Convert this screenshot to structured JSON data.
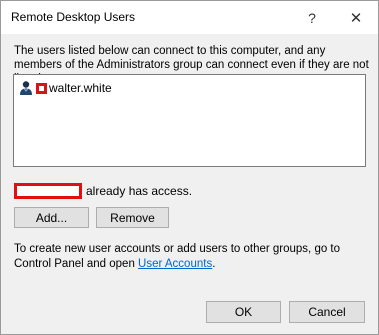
{
  "window": {
    "title": "Remote Desktop Users",
    "help_glyph": "?",
    "close_glyph": "✕"
  },
  "intro_text": "The users listed below can connect to this computer, and any members of the Administrators group can connect even if they are not listed.",
  "users": [
    {
      "name": "walter.white",
      "icon": "user-icon"
    }
  ],
  "access": {
    "suffix": "already has access."
  },
  "buttons": {
    "add": "Add...",
    "remove": "Remove",
    "ok": "OK",
    "cancel": "Cancel"
  },
  "footer": {
    "before_link": "To create new user accounts or add users to other groups, go to Control Panel and open ",
    "link": "User Accounts",
    "after_link": "."
  },
  "colors": {
    "redaction": "#e01010",
    "link": "#0066cc"
  }
}
